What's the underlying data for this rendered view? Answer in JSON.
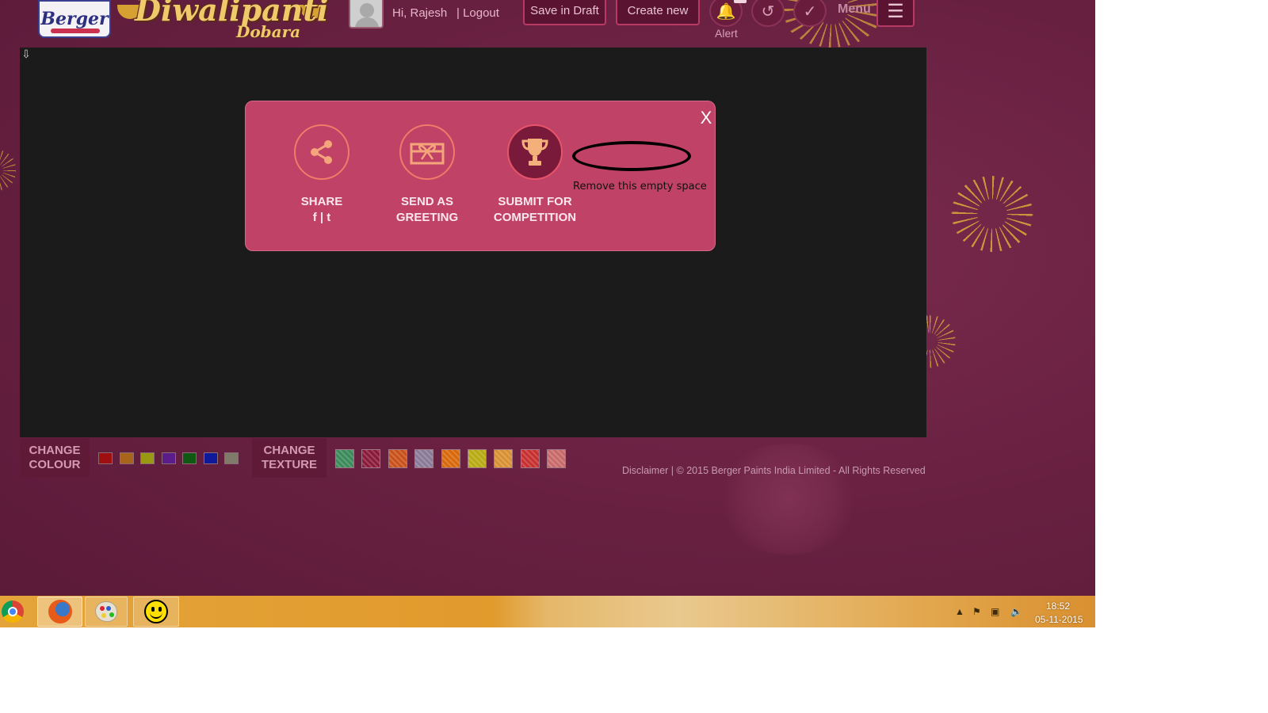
{
  "header": {
    "brand_logo": "Berger",
    "brand_title": "Diwalipanti",
    "brand_subtitle": "Dobara",
    "greeting": "Hi,  Rajesh",
    "logout": "|  Logout",
    "save_draft": "Save in Draft",
    "create_new": "Create new",
    "alert_label": "Alert",
    "menu_label": "Menu",
    "icons": {
      "alert": "bell-icon",
      "undo": "undo-icon",
      "done": "check-icon",
      "menu": "hamburger-icon",
      "avatar": "user-avatar-icon"
    }
  },
  "popup": {
    "close": "X",
    "actions": [
      {
        "line1": "SHARE",
        "line2": "f | t",
        "icon": "share-icon"
      },
      {
        "line1": "SEND AS",
        "line2": "GREETING",
        "icon": "gift-icon"
      },
      {
        "line1": "SUBMIT FOR",
        "line2": "COMPETITION",
        "icon": "trophy-icon"
      }
    ],
    "annotation": "Remove this empty space"
  },
  "controls": {
    "colour_label_1": "CHANGE",
    "colour_label_2": "COLOUR",
    "texture_label_1": "CHANGE",
    "texture_label_2": "TEXTURE",
    "colours": [
      "#a00f0f",
      "#a8641a",
      "#9a9a12",
      "#5a1d8a",
      "#0f5a12",
      "#0f1a9a",
      "#807a6a"
    ],
    "textures": [
      "#3a8a5a",
      "#8a1a3a",
      "#c8501a",
      "#8a7a98",
      "#d8680a",
      "#b8aa12",
      "#d89032",
      "#c83030",
      "#c86a6a"
    ]
  },
  "footer": {
    "text": "Disclaimer | © 2015 Berger Paints India Limited - All Rights Reserved"
  },
  "taskbar": {
    "apps": [
      "chrome-icon",
      "firefox-icon",
      "paint-icon",
      "smiley-icon"
    ],
    "time": "18:52",
    "date": "05-11-2015"
  }
}
